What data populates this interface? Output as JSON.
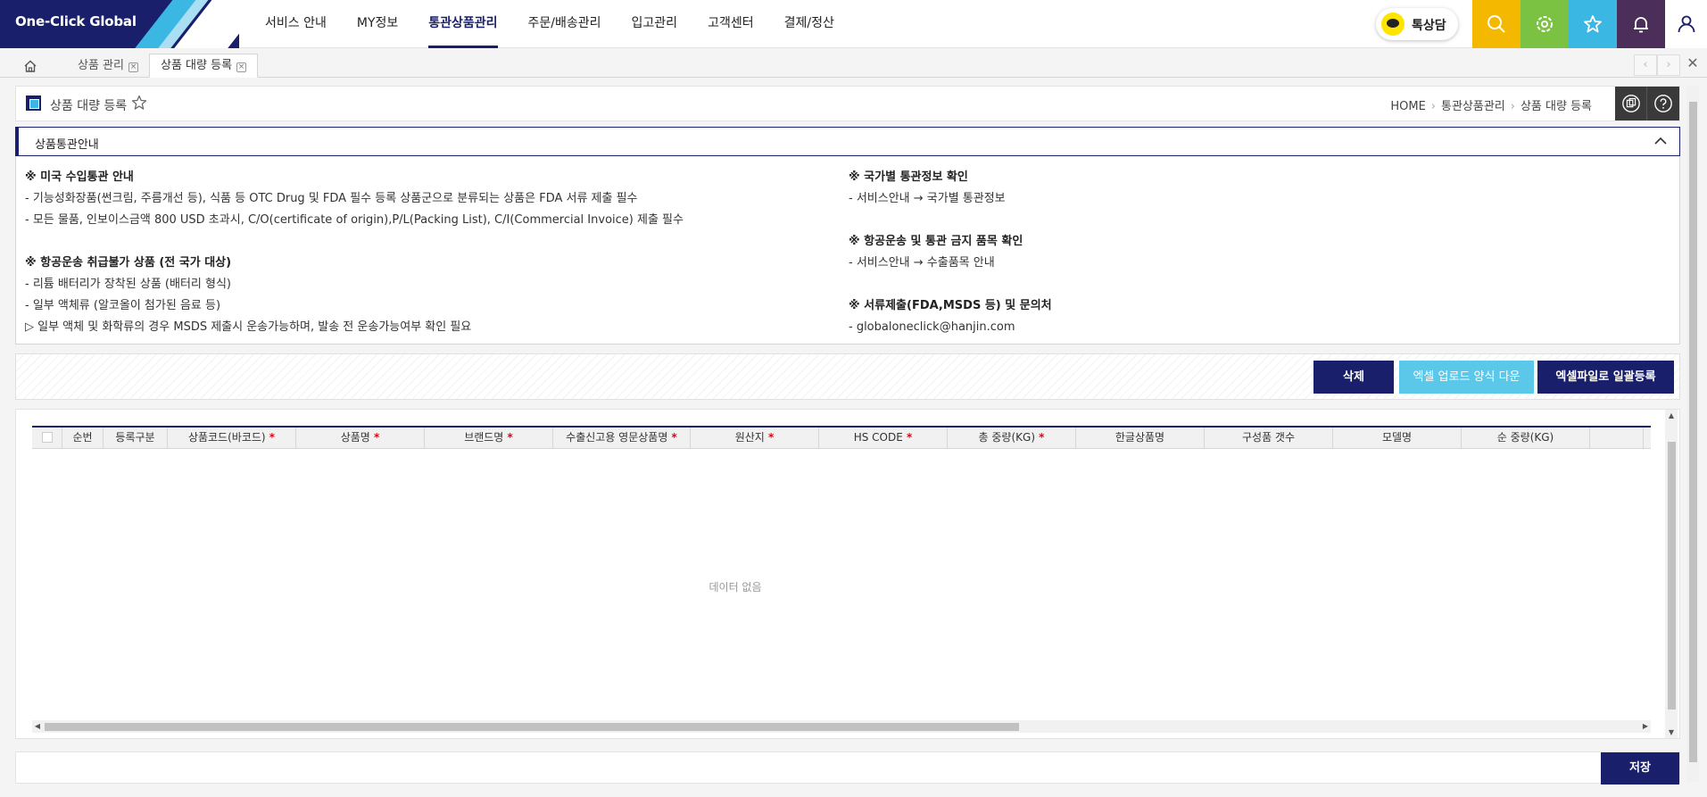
{
  "header": {
    "logo": "One-Click Global",
    "menu": [
      "서비스 안내",
      "MY정보",
      "통관상품관리",
      "주문/배송관리",
      "입고관리",
      "고객센터",
      "결제/정산"
    ],
    "active_menu_index": 2,
    "talk_label": "톡상담",
    "quick_buttons": [
      {
        "icon": "search-icon",
        "color": "#f5b800"
      },
      {
        "icon": "settings-icon",
        "color": "#7cc242"
      },
      {
        "icon": "star-icon",
        "color": "#3bb7e4"
      },
      {
        "icon": "bell-icon",
        "color": "#4b2e5a"
      },
      {
        "icon": "user-icon",
        "color": "#ffffff"
      }
    ]
  },
  "tabs": [
    {
      "label": "상품 관리",
      "active": false
    },
    {
      "label": "상품 대량 등록",
      "active": true
    }
  ],
  "page": {
    "title": "상품 대량 등록",
    "breadcrumb": [
      "HOME",
      "통관상품관리",
      "상품 대량 등록"
    ]
  },
  "notice": {
    "title": "상품통관안내",
    "left": [
      {
        "type": "h",
        "text": "※ 미국 수입통관 안내"
      },
      {
        "type": "t",
        "text": "- 기능성화장품(썬크림, 주름개선 등), 식품 등 OTC Drug 및 FDA 필수 등록 상품군으로 분류되는 상품은 FDA 서류 제출 필수"
      },
      {
        "type": "t",
        "text": "- 모든 물품, 인보이스금액 800 USD 초과시, C/O(certificate of origin),P/L(Packing List), C/I(Commercial Invoice) 제출 필수"
      },
      {
        "type": "gap",
        "text": ""
      },
      {
        "type": "h",
        "text": "※ 항공운송 취급불가 상품 (전 국가 대상)"
      },
      {
        "type": "t",
        "text": "- 리튬 배터리가 장착된 상품 (배터리 형식)"
      },
      {
        "type": "t",
        "text": "- 일부 액체류 (알코올이 첨가된 음료 등)"
      },
      {
        "type": "t",
        "text": "▷ 일부 액체 및 화학류의 경우 MSDS 제출시 운송가능하며, 발송 전 운송가능여부 확인 필요"
      }
    ],
    "right": [
      {
        "type": "h",
        "text": "※ 국가별 통관정보 확인"
      },
      {
        "type": "t",
        "text": "- 서비스안내 → 국가별 통관정보"
      },
      {
        "type": "gap",
        "text": ""
      },
      {
        "type": "h",
        "text": "※ 항공운송 및 통관 금지 품목 확인"
      },
      {
        "type": "t",
        "text": "- 서비스안내 → 수출품목 안내"
      },
      {
        "type": "gap",
        "text": ""
      },
      {
        "type": "h",
        "text": "※ 서류제출(FDA,MSDS 등) 및 문의처"
      },
      {
        "type": "t",
        "text": "- globaloneclick@hanjin.com"
      }
    ]
  },
  "buttons": {
    "delete": "삭제",
    "excel_form": "엑셀 업로드 양식 다운",
    "excel_upload": "엑셀파일로 일괄등록",
    "save": "저장"
  },
  "grid": {
    "columns": [
      {
        "label": "",
        "req": false
      },
      {
        "label": "순번",
        "req": false
      },
      {
        "label": "등록구분",
        "req": false
      },
      {
        "label": "상품코드(바코드)",
        "req": true
      },
      {
        "label": "상품명",
        "req": true
      },
      {
        "label": "브랜드명",
        "req": true
      },
      {
        "label": "수출신고용 영문상품명",
        "req": true
      },
      {
        "label": "원산지",
        "req": true
      },
      {
        "label": "HS CODE",
        "req": true
      },
      {
        "label": "총 중량(KG)",
        "req": true
      },
      {
        "label": "한글상품명",
        "req": false
      },
      {
        "label": "구성품 갯수",
        "req": false
      },
      {
        "label": "모델명",
        "req": false
      },
      {
        "label": "순 중량(KG)",
        "req": false
      },
      {
        "label": "",
        "req": false
      }
    ],
    "empty_text": "데이터 없음"
  }
}
